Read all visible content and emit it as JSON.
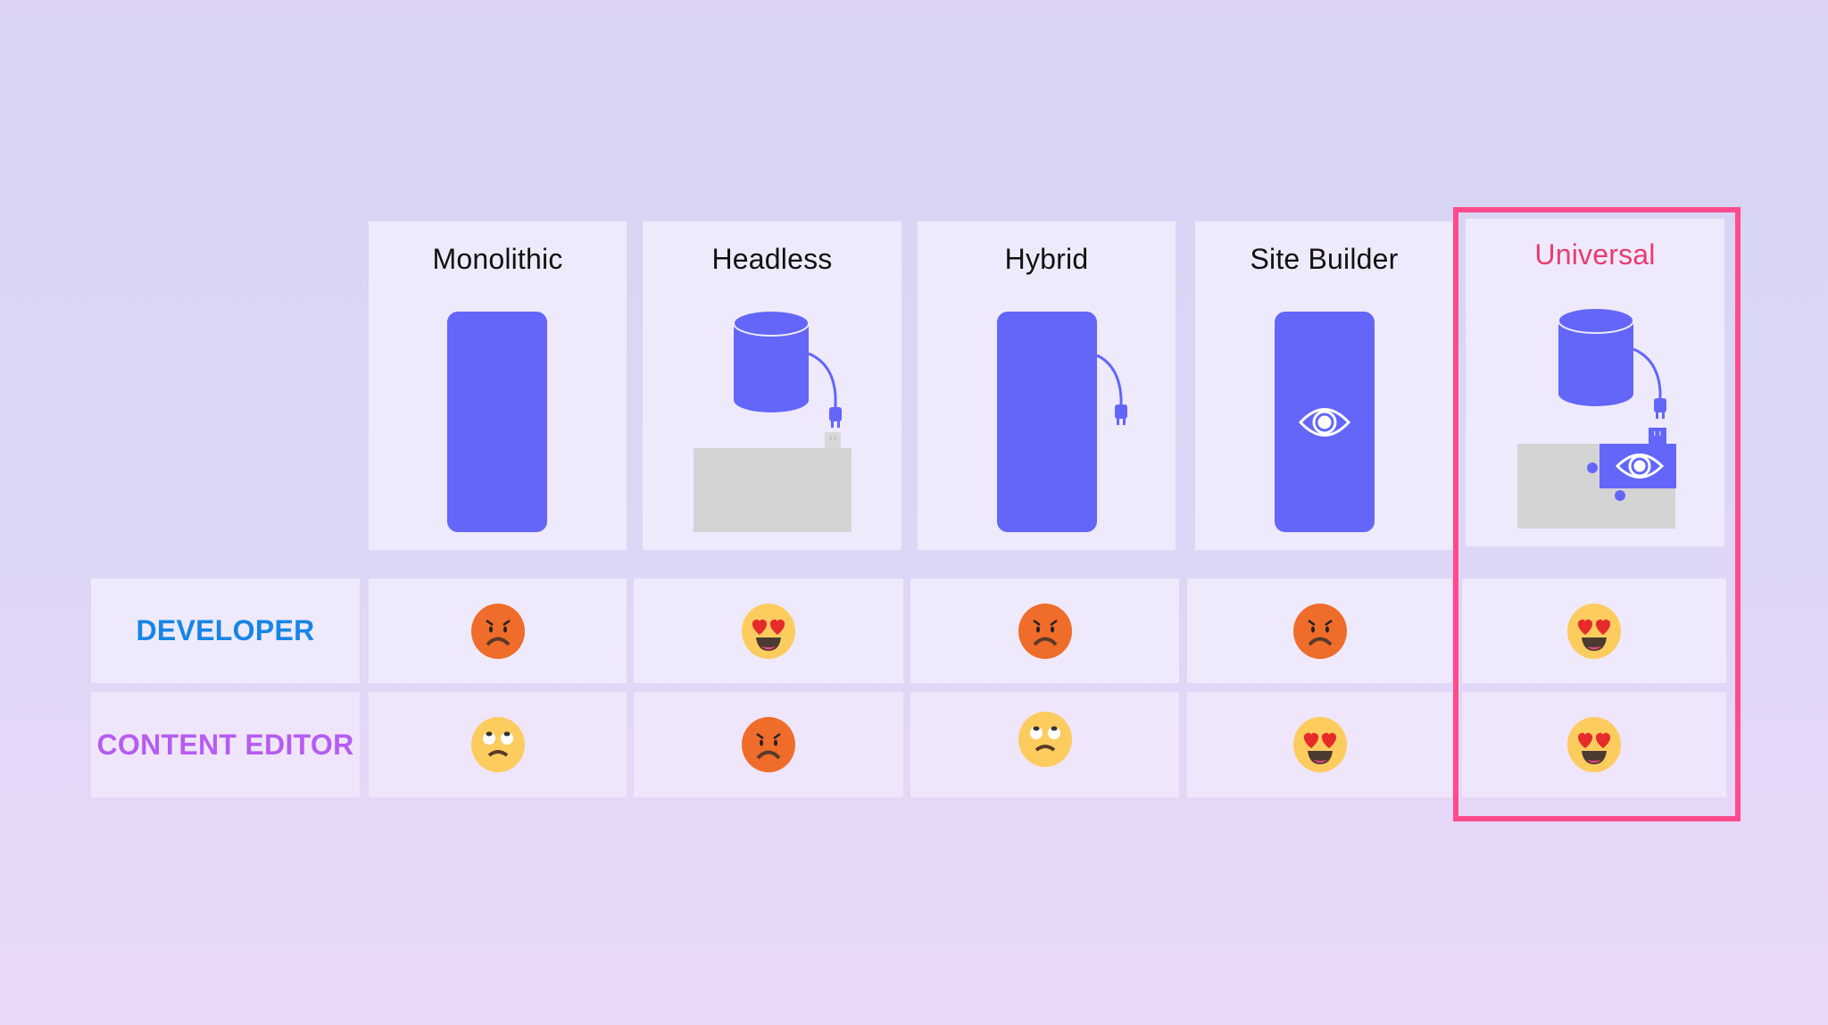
{
  "columns": [
    {
      "title": "Monolithic",
      "illustration": "monolith-block-icon",
      "highlighted": false
    },
    {
      "title": "Headless",
      "illustration": "database-plug-outlet-icon",
      "highlighted": false
    },
    {
      "title": "Hybrid",
      "illustration": "block-with-plug-icon",
      "highlighted": false
    },
    {
      "title": "Site Builder",
      "illustration": "block-with-eye-icon",
      "highlighted": false
    },
    {
      "title": "Universal",
      "illustration": "database-plug-puzzle-eye-icon",
      "highlighted": true
    }
  ],
  "rows": [
    {
      "label": "DEVELOPER",
      "color": "#1685e6",
      "ratings": [
        "angry",
        "heart-eyes",
        "angry",
        "angry",
        "heart-eyes"
      ]
    },
    {
      "label": "CONTENT EDITOR",
      "color": "#b65cf2",
      "ratings": [
        "eye-roll",
        "angry",
        "eye-roll",
        "heart-eyes",
        "heart-eyes"
      ]
    }
  ],
  "colors": {
    "accent_blue": "#6366f9",
    "highlight": "#ff4b8b",
    "highlight_text": "#ea3b72",
    "frontend_gray": "#d4d4d4"
  }
}
